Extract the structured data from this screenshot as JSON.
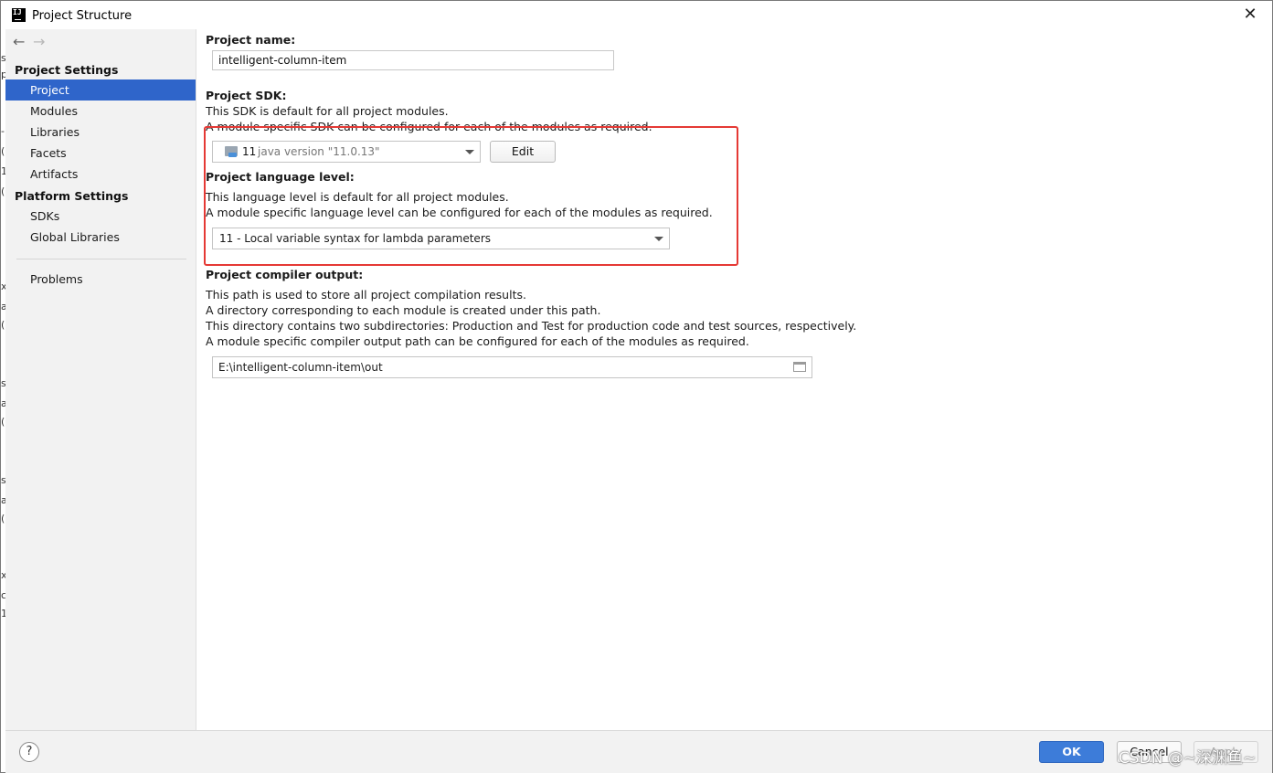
{
  "window": {
    "title": "Project Structure"
  },
  "sidebar": {
    "project_settings_header": "Project Settings",
    "project_items": [
      "Project",
      "Modules",
      "Libraries",
      "Facets",
      "Artifacts"
    ],
    "platform_settings_header": "Platform Settings",
    "platform_items": [
      "SDKs",
      "Global Libraries"
    ],
    "problems": "Problems",
    "selected": "Project"
  },
  "content": {
    "project_name_label": "Project name:",
    "project_name_value": "intelligent-column-item",
    "sdk_label": "Project SDK:",
    "sdk_desc1": "This SDK is default for all project modules.",
    "sdk_desc2": "A module specific SDK can be configured for each of the modules as required.",
    "sdk_combo_name": "11",
    "sdk_combo_version": "java version \"11.0.13\"",
    "edit_button": "Edit",
    "lang_label": "Project language level:",
    "lang_desc1": "This language level is default for all project modules.",
    "lang_desc2": "A module specific language level can be configured for each of the modules as required.",
    "lang_value": "11 - Local variable syntax for lambda parameters",
    "output_label": "Project compiler output:",
    "output_desc1": "This path is used to store all project compilation results.",
    "output_desc2": "A directory corresponding to each module is created under this path.",
    "output_desc3": "This directory contains two subdirectories: Production and Test for production code and test sources, respectively.",
    "output_desc4": "A module specific compiler output path can be configured for each of the modules as required.",
    "output_path": "E:\\intelligent-column-item\\out"
  },
  "footer": {
    "help": "?",
    "ok": "OK",
    "cancel": "Cancel",
    "apply": "Apply"
  },
  "watermark": "CSDN @~深渊鱼~",
  "colors": {
    "selection": "#2f65ca",
    "highlight_box": "#e53935",
    "ok_button": "#3d7cd9"
  }
}
